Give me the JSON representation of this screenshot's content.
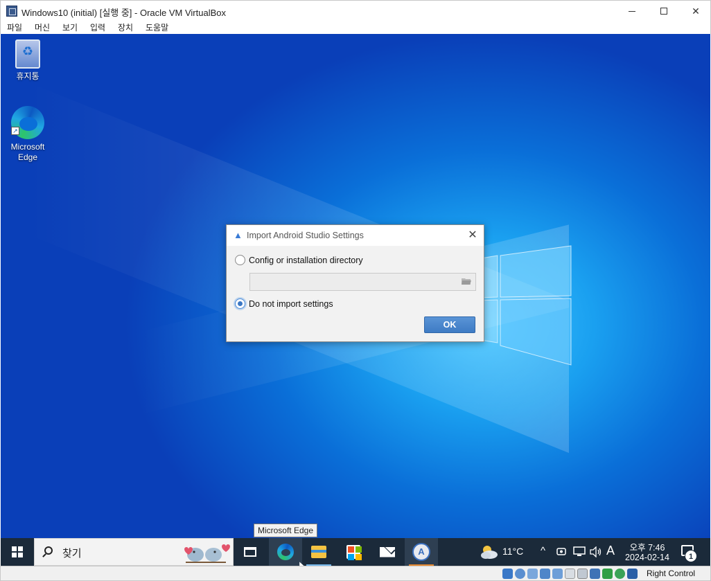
{
  "vbox": {
    "title": "Windows10 (initial) [실행 중] - Oracle VM VirtualBox",
    "menu": [
      "파일",
      "머신",
      "보기",
      "입력",
      "장치",
      "도움말"
    ],
    "host_key_label": "Right Control"
  },
  "desktop": {
    "icons": [
      {
        "label": "휴지통",
        "icon": "recycle-bin-icon"
      },
      {
        "label": "Microsoft Edge",
        "icon": "edge-icon"
      }
    ]
  },
  "dialog": {
    "title": "Import Android Studio Settings",
    "options": [
      {
        "label": "Config or installation directory",
        "checked": false
      },
      {
        "label": "Do not import settings",
        "checked": true
      }
    ],
    "directory_value": "",
    "ok_label": "OK"
  },
  "tooltip": "Microsoft Edge",
  "taskbar": {
    "search_placeholder": "찾기",
    "apps": [
      "task-view-icon",
      "edge-icon",
      "file-explorer-icon",
      "store-icon",
      "mail-icon",
      "android-studio-icon"
    ],
    "weather_temp": "11°C",
    "tray_glyphs": [
      "^",
      "A"
    ],
    "time": "오후 7:46",
    "date": "2024-02-14",
    "notifications_count": "1"
  },
  "colors": {
    "desktop_blue": "#0a6fd8",
    "taskbar": "#1b2a3a",
    "ok_button": "#4a86cc",
    "accent_underline": "#76b9ed"
  }
}
